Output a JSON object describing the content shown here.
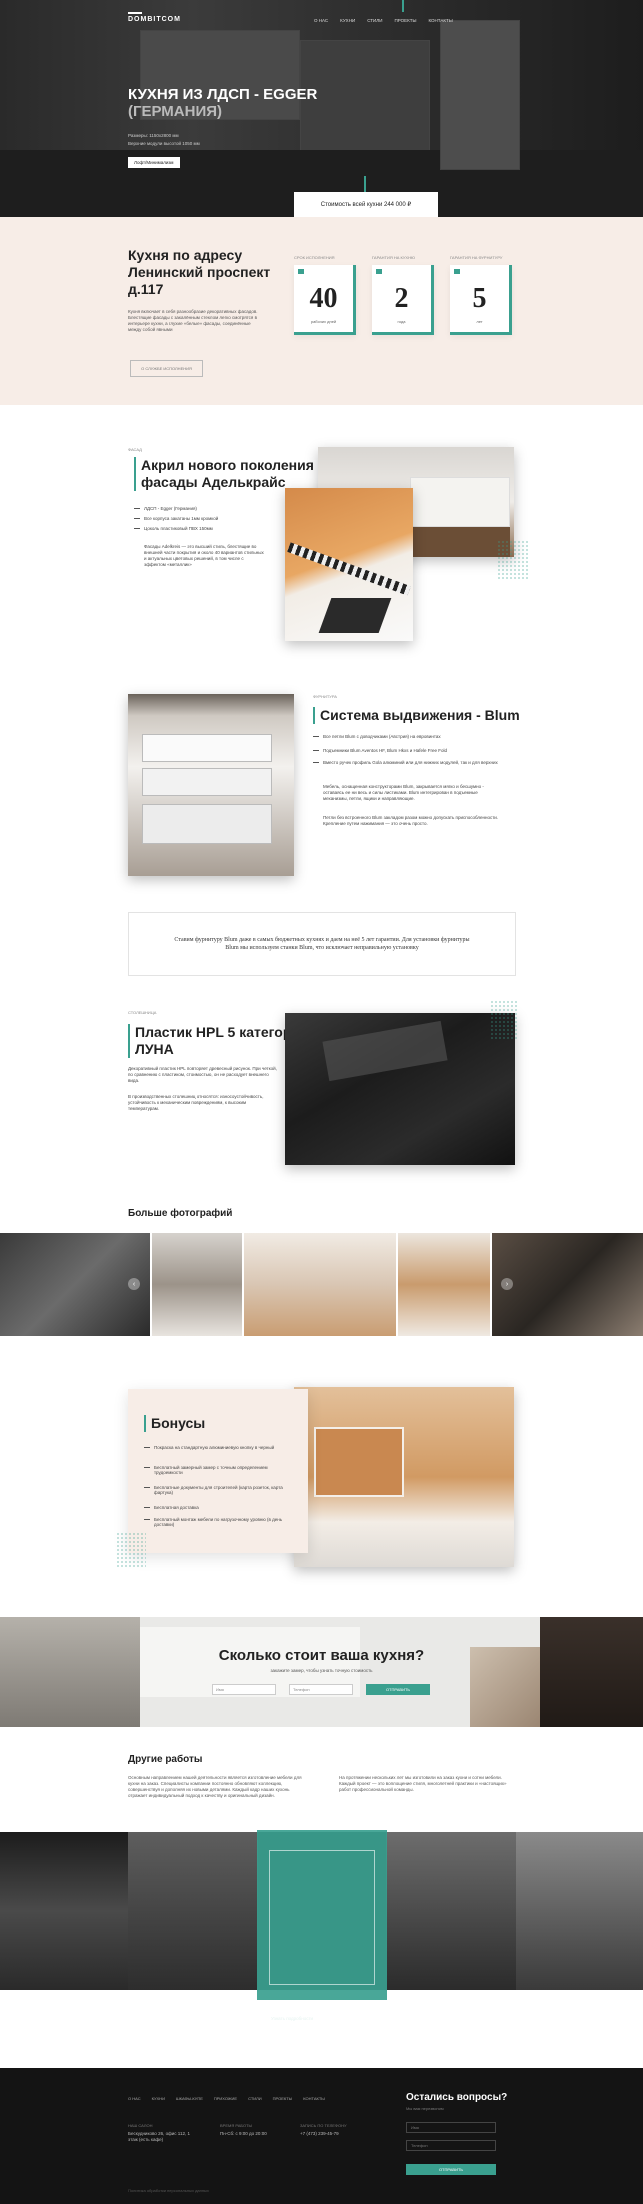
{
  "header": {
    "logo": "DOMBITCOM",
    "nav": [
      "О НАС",
      "КУХНИ",
      "СТИЛИ",
      "ПРОЕКТЫ",
      "КОНТАКТЫ"
    ]
  },
  "hero": {
    "title_line1": "КУХНЯ ИЗ ЛДСП - EGGER",
    "title_line2": "(ГЕРМАНИЯ)",
    "spec1": "Размеры: 1150х2800 мм",
    "spec2": "Верхние модули высотой 1050 мм",
    "tag": "Лофт/Минимализм",
    "price": "Стоимость всей кухни 244 000 ₽"
  },
  "address": {
    "title": "Кухня по адресу Ленинский проспект д.117",
    "text": "Кухня включает в себя разнообразие декоративных фасадов. Блестящие фасады с закалённым стеклом легко смотрятся в интерьере кухни, а глухие «белые» фасады, соединённые между собой явными",
    "button": "О СЛУЖБЕ ИСПОЛНЕНИЯ",
    "stats": [
      {
        "label": "СРОК ИСПОЛНЕНИЯ",
        "value": "40",
        "unit": "рабочих дней"
      },
      {
        "label": "ГАРАНТИЯ НА КУХНЮ",
        "value": "2",
        "unit": "года"
      },
      {
        "label": "ГАРАНТИЯ НА ФУРНИТУРУ",
        "value": "5",
        "unit": "лет"
      }
    ]
  },
  "facade": {
    "label": "ФАСАД",
    "title": "Акрил нового поколения - фасады Аделькрайс",
    "bullets": [
      "ЛДСП - Egger (Германия)",
      "Все корпуса закатаны 1мм кромкой",
      "Цоколь пластиковый ПВХ 150мм"
    ],
    "text": "Фасады Adelkreis — это высший стиль, блестящие во внешней части покрытия и около 40 вариантов стильных и актуальных цветовых решений, в том числе с эффектом «металлик»"
  },
  "blum": {
    "label": "ФУРНИТУРА",
    "title": "Система выдвижения - Blum",
    "bullets": [
      "Все петли Blum с доводчиками (Австрия) на евровинтах",
      "Подъемники Blum Aventos HF, Blum Hkxs и Hafele Free Fold",
      "Вместо ручек профиль Gola алюминий или для нижних модулей, так и для верхних"
    ],
    "text1": "Мебель, оснащенная конструкторами Blum, закрывается мягко и бесшумно - оставаясь ее ни весь и силы листиками. Blum интегрирован в подъемные механизмы, петли, ящики и направляющие.",
    "text2": "Петли без встроенного Blum закладом разом можно допускать приспособленности. Крепление путем нажимания — это очень просто."
  },
  "note": "Ставим фурнитуру Blum даже в самых бюджетных кухнях и даем на неё 5 лет гарантии. Для установки фурнитуры Blum мы используем станки Blum, что исключает неправильную установку",
  "worktop": {
    "label": "СТОЛЕШНИЦА",
    "title": "Пластик HPL 5 категории ЛУНА",
    "text1": "Декоративный пластик HPL повторяет древесный рисунок. При четкой, по сравнению с пластиком, стоимостью, он не расходует внешнего вида.",
    "text2": "В производственных столешниц относятся: износоустойчивость, устойчивость к механическим повреждениям, к высоким температурам."
  },
  "gallery": {
    "title": "Больше фотографий",
    "prev": "‹",
    "next": "›"
  },
  "bonus": {
    "title": "Бонусы",
    "items": [
      "Покраска на стандартную алюминиевую кнопку в черный",
      "Бесплатный замерный замер с точным определением трудоемкости",
      "Бесплатные документы для строителей (карта розеток, карта фартука)",
      "Бесплатная доставка",
      "Бесплатный монтаж мебели по нагрузочному уровню (в день доставки)"
    ]
  },
  "calc": {
    "title": "Сколько стоит ваша кухня?",
    "subtitle": "закажите замер, чтобы узнать точную стоимость",
    "field1": "Имя",
    "field2": "Телефон",
    "button": "ОТПРАВИТЬ"
  },
  "other": {
    "title": "Другие работы",
    "text1": "Основным направлением нашей деятельности является изготовление мебели для кухни на заказ. Специалисты компании постоянно обновляют коллекцию, совершенствуя и дополняя их новыми деталями. Каждый кадр наших кухонь отражает индивидуальный подход к качеству и оригинальный дизайн.",
    "text2": "На протяжении нескольких лет мы изготовили на заказ кухни и сотни мебели. Каждый проект — это воплощение стиля, многолетней практики и «настоящих» работ профессиональной команды.",
    "project_title": "Название проекта",
    "project_link": "Узнать подробности"
  },
  "footer": {
    "nav": [
      "О НАС",
      "КУХНИ",
      "ШКАФЫ-КУПЕ",
      "ПРИХОЖИЕ",
      "СТИЛИ",
      "ПРОЕКТЫ",
      "КОНТАКТЫ"
    ],
    "address_label": "НАШ САЛОН",
    "address": "Бескудниково 26, офис 112, 1 этаж (есть кафе)",
    "hours_label": "ВРЕМЯ РАБОТЫ",
    "hours": "Пн-Сб: с 9:00 до 20:00",
    "phone_label": "ЗАПИСЬ ПО ТЕЛЕФОНУ",
    "phone": "+7 (473) 239-45-79",
    "question": "Остались вопросы?",
    "question_sub": "Мы вам перезвоним",
    "name_placeholder": "Имя",
    "phone_placeholder": "Телефон",
    "send": "ОТПРАВИТЬ",
    "policy": "Политика обработки персональных данных"
  },
  "colors": {
    "accent": "#3aa08f",
    "beige": "#f7ede7",
    "dark": "#141414"
  }
}
